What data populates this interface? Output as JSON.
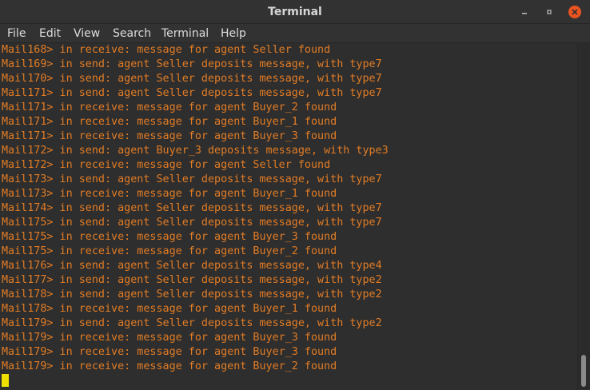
{
  "window": {
    "title": "Terminal"
  },
  "menu": {
    "items": [
      "File",
      "Edit",
      "View",
      "Search",
      "Terminal",
      "Help"
    ]
  },
  "terminal": {
    "text_color": "#e27c25",
    "cursor_color": "#f0e000",
    "lines": [
      "Mail168> in receive: message for agent Seller found",
      "Mail169> in send: agent Seller deposits message, with type7",
      "Mail170> in send: agent Seller deposits message, with type7",
      "Mail171> in send: agent Seller deposits message, with type7",
      "Mail171> in receive: message for agent Buyer_2 found",
      "Mail171> in receive: message for agent Buyer_1 found",
      "Mail171> in receive: message for agent Buyer_3 found",
      "Mail172> in send: agent Buyer_3 deposits message, with type3",
      "Mail172> in receive: message for agent Seller found",
      "Mail173> in send: agent Seller deposits message, with type7",
      "Mail173> in receive: message for agent Buyer_1 found",
      "Mail174> in send: agent Seller deposits message, with type7",
      "Mail175> in send: agent Seller deposits message, with type7",
      "Mail175> in receive: message for agent Buyer_3 found",
      "Mail175> in receive: message for agent Buyer_2 found",
      "Mail176> in send: agent Seller deposits message, with type4",
      "Mail177> in send: agent Seller deposits message, with type2",
      "Mail178> in send: agent Seller deposits message, with type2",
      "Mail178> in receive: message for agent Buyer_1 found",
      "Mail179> in send: agent Seller deposits message, with type2",
      "Mail179> in receive: message for agent Buyer_3 found",
      "Mail179> in receive: message for agent Buyer_3 found",
      "Mail179> in receive: message for agent Buyer_2 found"
    ]
  }
}
